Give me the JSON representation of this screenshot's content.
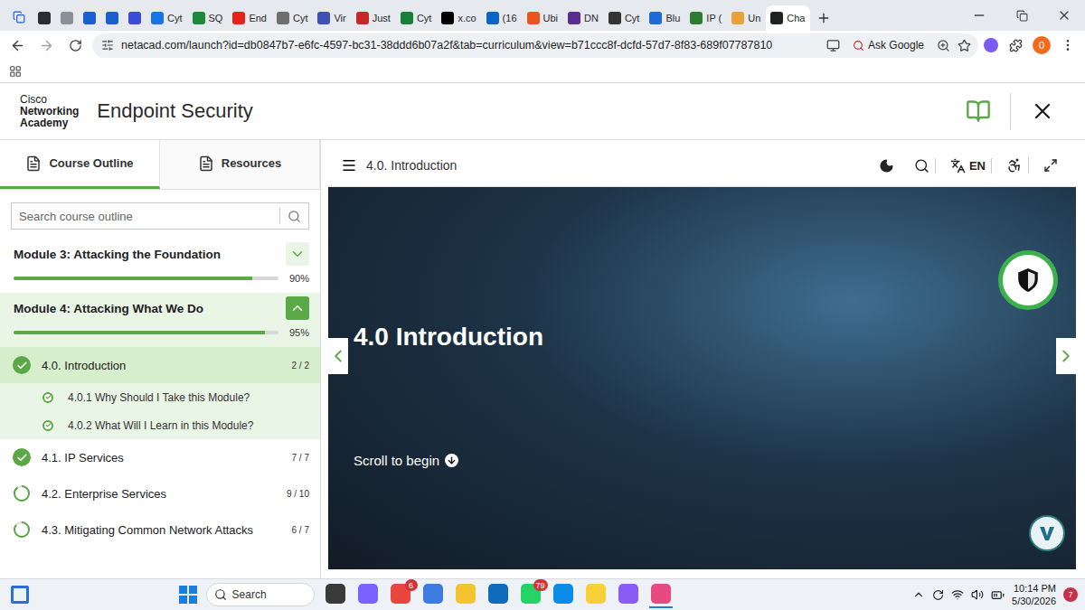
{
  "browser": {
    "tabs": [
      {
        "color": "#2b2d31",
        "selected": false
      },
      {
        "color": "#8a8f98",
        "selected": false
      },
      {
        "color": "#1a5fd0",
        "selected": false
      },
      {
        "color": "#1a5fd0",
        "selected": false
      },
      {
        "color": "#3b4bd8",
        "selected": false
      },
      {
        "label": "Cyt",
        "color": "#1a73e8",
        "selected": false
      },
      {
        "label": "SQ",
        "color": "#1d8a3b",
        "selected": false
      },
      {
        "label": "End",
        "color": "#e62117",
        "selected": false
      },
      {
        "label": "Cyt",
        "color": "#6e6e6e",
        "selected": false
      },
      {
        "label": "Vir",
        "color": "#3f51b5",
        "selected": false
      },
      {
        "label": "Just",
        "color": "#c62828",
        "selected": false
      },
      {
        "label": "Cyt",
        "color": "#188038",
        "selected": false
      },
      {
        "label": "x.co",
        "color": "#000000",
        "selected": false
      },
      {
        "label": "(16",
        "color": "#0a66c2",
        "selected": false
      },
      {
        "label": "Ubi",
        "color": "#e95420",
        "selected": false
      },
      {
        "label": "DN",
        "color": "#5c2d91",
        "selected": false
      },
      {
        "label": "Cyt",
        "color": "#333333",
        "selected": false
      },
      {
        "label": "Blu",
        "color": "#1e6bd6",
        "selected": false
      },
      {
        "label": "IP (",
        "color": "#2e7d32",
        "selected": false
      },
      {
        "label": "Un",
        "color": "#e9a23b",
        "selected": false
      },
      {
        "label": "Cha",
        "color": "#202123",
        "selected": true
      }
    ],
    "url": "netacad.com/launch?id=db0847b7-e6fc-4597-bc31-38ddd6b07a2f&tab=curriculum&view=b71ccc8f-dcfd-57d7-8f83-689f07787810",
    "ask_google": "Ask Google",
    "profile": "0"
  },
  "header": {
    "logo": [
      "Cisco",
      "Networking",
      "Academy"
    ],
    "title": "Endpoint Security"
  },
  "sidebar": {
    "tabs": [
      {
        "label": "Course Outline",
        "selected": true
      },
      {
        "label": "Resources",
        "selected": false
      }
    ],
    "search": {
      "placeholder": "Search course outline"
    },
    "modules": [
      {
        "title": "Module 3: Attacking the Foundation",
        "progress": "90%",
        "level": 0.9,
        "expanded": false,
        "items": []
      },
      {
        "title": "Module 4: Attacking What We Do",
        "progress": "95%",
        "level": 0.95,
        "expanded": true,
        "items": [
          {
            "title": "4.0. Introduction",
            "count": "2 / 2",
            "complete": true,
            "level": 1,
            "selected": true,
            "subitems": [
              {
                "title": "4.0.1 Why Should I Take this Module?",
                "complete": true
              },
              {
                "title": "4.0.2 What Will I Learn in this Module?",
                "complete": true
              }
            ]
          },
          {
            "title": "4.1. IP Services",
            "count": "7 / 7",
            "complete": true,
            "level": 1,
            "selected": false,
            "subitems": []
          },
          {
            "title": "4.2. Enterprise Services",
            "count": "9 / 10",
            "complete": false,
            "level": 0.9,
            "selected": false,
            "subitems": []
          },
          {
            "title": "4.3. Mitigating Common Network Attacks",
            "count": "6 / 7",
            "complete": false,
            "level": 0.857,
            "selected": false,
            "subitems": []
          }
        ]
      }
    ]
  },
  "content": {
    "title": "4.0. Introduction",
    "language": "EN",
    "hero": {
      "title": "4.0 Introduction",
      "hint": "Scroll to begin"
    }
  },
  "taskbar": {
    "search": "Search",
    "apps": [
      {
        "color": "#3a3a3a"
      },
      {
        "color": "#7b61ff"
      },
      {
        "color": "#e8453c",
        "badge": "6"
      },
      {
        "color": "#3d7be0"
      },
      {
        "color": "#f4c430"
      },
      {
        "color": "#0f6cbd"
      },
      {
        "color": "#25d366",
        "badge": "79"
      },
      {
        "color": "#0c8ce9"
      },
      {
        "color": "#f7d038"
      },
      {
        "color": "#8a5cf6"
      },
      {
        "color": "#e84a7f",
        "active": true
      }
    ],
    "time": "10:14 PM",
    "date": "5/30/2026",
    "notifications": "7"
  }
}
